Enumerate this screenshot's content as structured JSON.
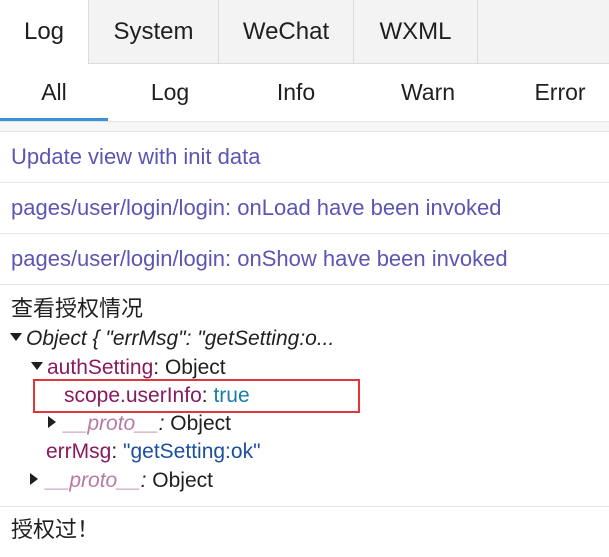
{
  "top_tabs": [
    {
      "label": "Log",
      "active": true
    },
    {
      "label": "System",
      "active": false
    },
    {
      "label": "WeChat",
      "active": false
    },
    {
      "label": "WXML",
      "active": false
    }
  ],
  "filter_tabs": [
    {
      "label": "All",
      "active": true
    },
    {
      "label": "Log",
      "active": false
    },
    {
      "label": "Info",
      "active": false
    },
    {
      "label": "Warn",
      "active": false
    },
    {
      "label": "Error",
      "active": false
    }
  ],
  "logs": [
    "Update view with init data",
    "pages/user/login/login: onLoad have been invoked",
    "pages/user/login/login: onShow have been invoked"
  ],
  "object_entry": {
    "title": "查看授权情况",
    "summary": "Object { \"errMsg\": \"getSetting:o...",
    "auth_key": "authSetting",
    "auth_type": "Object",
    "scope_key": "scope.userInfo",
    "scope_value": "true",
    "proto_key": "__proto__",
    "proto_type": "Object",
    "errmsg_key": "errMsg",
    "errmsg_value": "\"getSetting:ok\"",
    "colon": ":"
  },
  "last_log": "授权过！",
  "colors": {
    "accent": "#3d8fd6",
    "log_text": "#5b55b3",
    "highlight": "#e0353a"
  }
}
